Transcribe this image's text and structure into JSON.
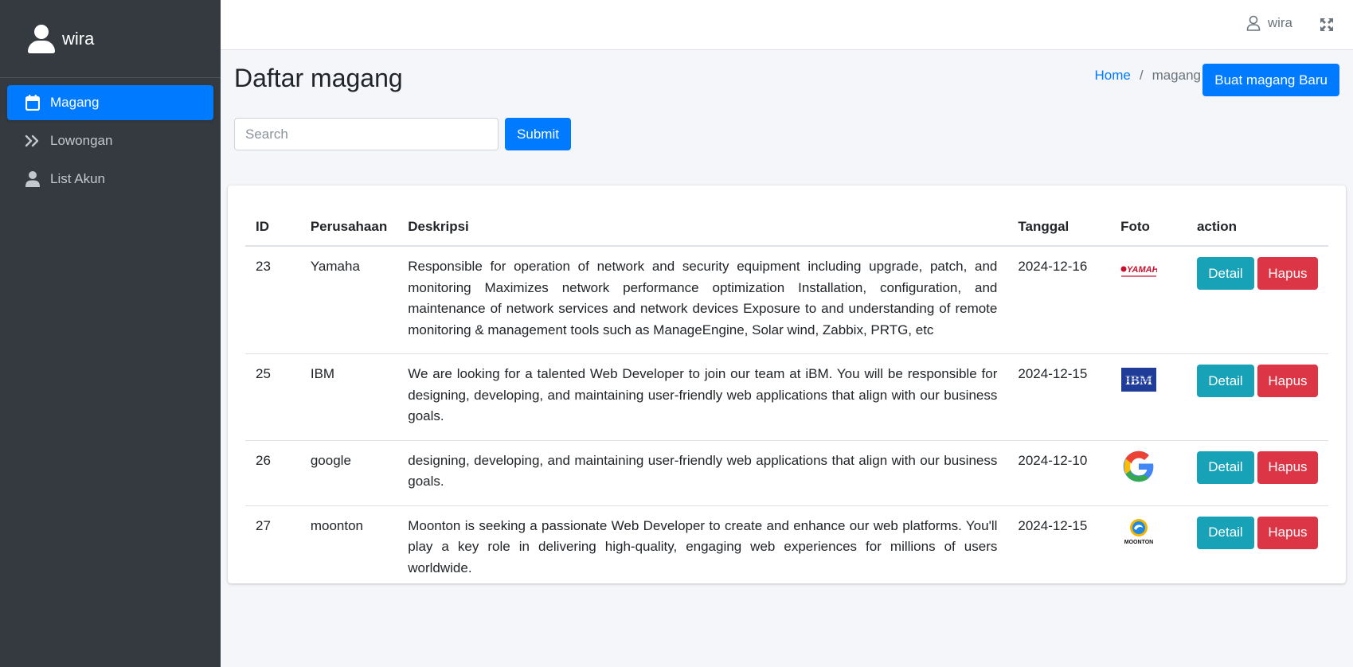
{
  "sidebar": {
    "user_name": "wira",
    "items": [
      {
        "label": "Magang",
        "icon": "calendar-icon",
        "active": true
      },
      {
        "label": "Lowongan",
        "icon": "double-chevron-right-icon",
        "active": false
      },
      {
        "label": "List Akun",
        "icon": "user-icon",
        "active": false
      }
    ]
  },
  "topbar": {
    "user_name": "wira",
    "expand_icon": "fullscreen-icon"
  },
  "header": {
    "title": "Daftar magang",
    "breadcrumb": {
      "home": "Home",
      "separator": "/",
      "current": "magang"
    },
    "new_button": "Buat magang Baru"
  },
  "search": {
    "placeholder": "Search",
    "value": "",
    "submit_label": "Submit"
  },
  "table": {
    "columns": [
      "ID",
      "Perusahaan",
      "Deskripsi",
      "Tanggal",
      "Foto",
      "action"
    ],
    "rows": [
      {
        "id": "23",
        "company": "Yamaha",
        "description": "Responsible for operation of network and security equipment including upgrade, patch, and monitoring Maximizes network performance optimization Installation, configuration, and maintenance of network services and network devices Exposure to and understanding of remote monitoring & management tools such as ManageEngine, Solar wind, Zabbix, PRTG, etc",
        "date": "2024-12-16",
        "logo": "yamaha-logo",
        "detail": "Detail",
        "delete": "Hapus"
      },
      {
        "id": "25",
        "company": "IBM",
        "description": "We are looking for a talented Web Developer to join our team at iBM. You will be responsible for designing, developing, and maintaining user-friendly web applications that align with our business goals.",
        "date": "2024-12-15",
        "logo": "ibm-logo",
        "detail": "Detail",
        "delete": "Hapus"
      },
      {
        "id": "26",
        "company": "google",
        "description": "designing, developing, and maintaining user-friendly web applications that align with our business goals.",
        "date": "2024-12-10",
        "logo": "google-logo",
        "detail": "Detail",
        "delete": "Hapus"
      },
      {
        "id": "27",
        "company": "moonton",
        "description": "Moonton is seeking a passionate Web Developer to create and enhance our web platforms. You'll play a key role in delivering high-quality, engaging web experiences for millions of users worldwide.",
        "date": "2024-12-15",
        "logo": "moonton-logo",
        "detail": "Detail",
        "delete": "Hapus"
      }
    ]
  },
  "colors": {
    "sidebar_bg": "#343a40",
    "primary": "#007bff",
    "info": "#17a2b8",
    "danger": "#dc3545",
    "page_bg": "#f4f6f9"
  }
}
